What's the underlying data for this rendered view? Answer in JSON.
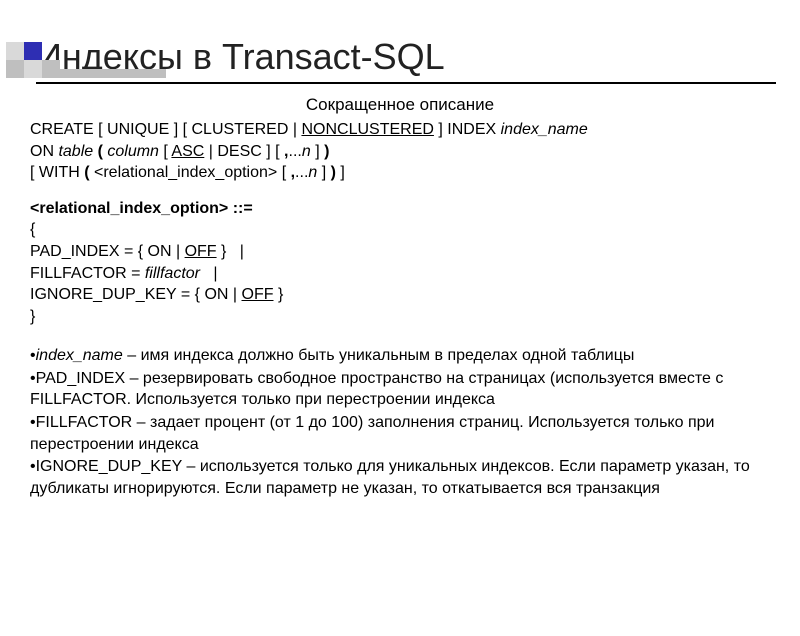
{
  "title": "Индексы в Transact-SQL",
  "subhead": "Сокращенное описание",
  "syntax": {
    "t1a": "CREATE [ UNIQUE ] [ CLUSTERED | ",
    "t1b": "NONCLUSTERED",
    "t1c": " ] INDEX ",
    "t1d": "index_name",
    "t2a": "ON ",
    "t2b": "table",
    "t2c": " ( ",
    "t2d": "column",
    "t2e": " [ ",
    "t2f": "ASC",
    "t2g": " | DESC ] [ ",
    "t2h": ",",
    "t2i": "...",
    "t2j": "n",
    "t2k": " ] ",
    "t2l": ")",
    "t3a": "[ WITH ",
    "t3b": "(",
    "t3c": " <relational_index_option> [ ",
    "t3d": ",",
    "t3e": "...",
    "t3f": "n",
    "t3g": " ] ",
    "t3h": ")",
    "t3i": " ]"
  },
  "rio": {
    "head": "<relational_index_option> ::=",
    "open": "{",
    "l1a": "PAD_INDEX = { ON | ",
    "l1b": "OFF",
    "l1c": " }   |",
    "l2a": "FILLFACTOR = ",
    "l2b": "fillfactor",
    "l2c": "   |",
    "l3a": "IGNORE_DUP_KEY = { ON | ",
    "l3b": "OFF",
    "l3c": " }",
    "close": "}"
  },
  "bullets": {
    "b1term": "index_name",
    "b1text": " – имя индекса должно быть уникальным в пределах одной таблицы",
    "b2term": "PAD_INDEX",
    "b2text": " – резервировать свободное пространство на страницах (используется вместе с FILLFACTOR. Используется только при перестроении индекса",
    "b3term": "FILLFACTOR",
    "b3text": " – задает процент (от 1 до 100) заполнения  страниц. Используется только при перестроении индекса",
    "b4term": "IGNORE_DUP_KEY",
    "b4text": " – используется только для уникальных индексов. Если параметр указан, то дубликаты игнорируются. Если параметр не указан, то откатывается вся транзакция"
  }
}
